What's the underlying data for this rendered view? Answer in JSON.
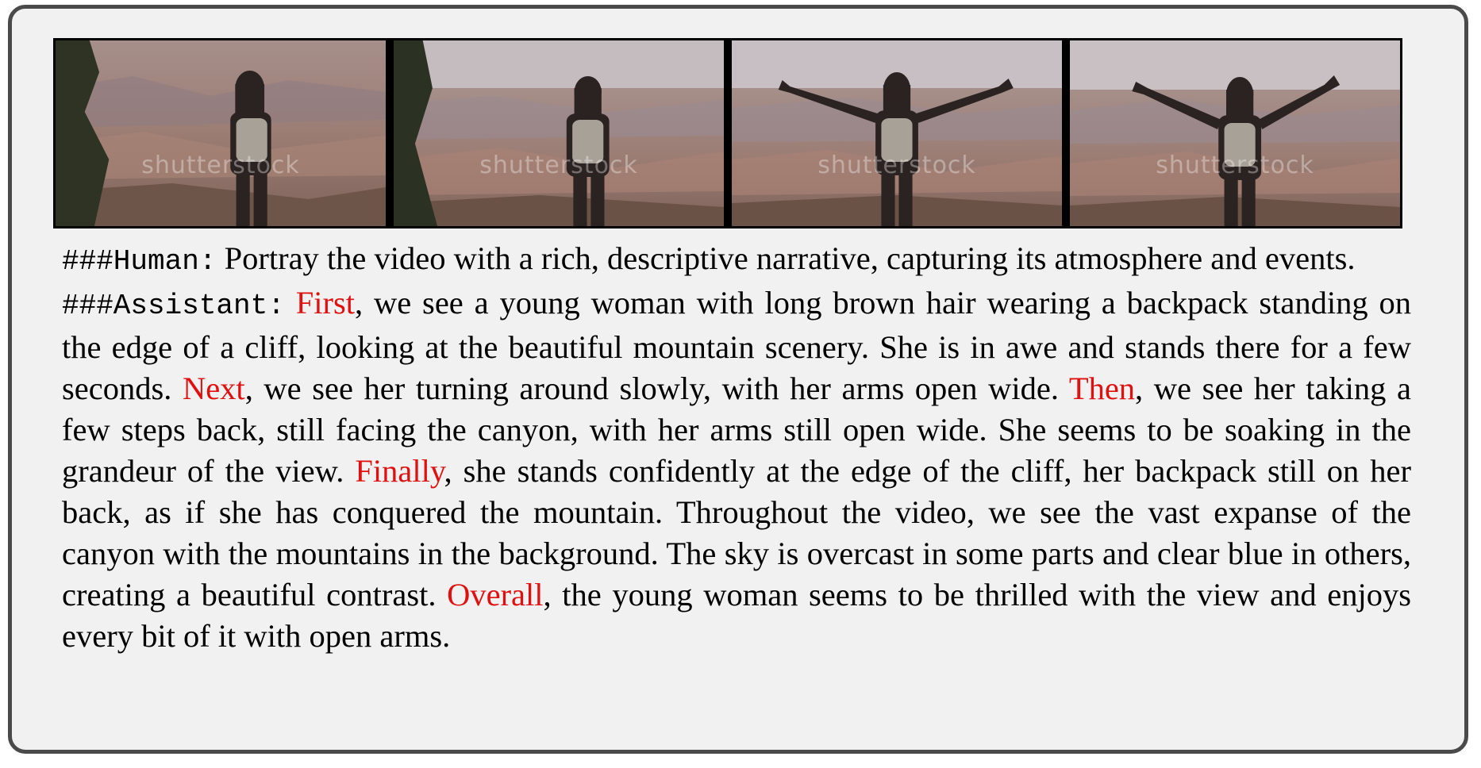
{
  "frames": [
    {
      "watermark": "shutterstock"
    },
    {
      "watermark": "shutterstock"
    },
    {
      "watermark": "shutterstock"
    },
    {
      "watermark": "shutterstock"
    }
  ],
  "human": {
    "label": "###Human:",
    "text": " Portray the video with a rich, descriptive narrative, capturing its atmosphere and events."
  },
  "assistant": {
    "label": "###Assistant:",
    "segments": [
      {
        "text": " ",
        "highlight": false
      },
      {
        "text": "First",
        "highlight": true
      },
      {
        "text": ", we see a young woman with long brown hair wearing a backpack standing on the edge of a cliff, looking at the beautiful mountain scenery. She is in awe and stands there for a few seconds. ",
        "highlight": false
      },
      {
        "text": "Next",
        "highlight": true
      },
      {
        "text": ", we see her turning around slowly, with her arms open wide. ",
        "highlight": false
      },
      {
        "text": "Then",
        "highlight": true
      },
      {
        "text": ", we see her taking a few steps back, still facing the canyon, with her arms still open wide. She seems to be soaking in the grandeur of the view. ",
        "highlight": false
      },
      {
        "text": "Finally",
        "highlight": true
      },
      {
        "text": ", she stands confidently at the edge of the cliff, her backpack still on her back, as if she has conquered the mountain. Throughout the video, we see the vast expanse of the canyon with the mountains in the background. The sky is overcast in some parts and clear blue in others, creating a beautiful contrast. ",
        "highlight": false
      },
      {
        "text": "Overall",
        "highlight": true
      },
      {
        "text": ", the young woman seems to be thrilled with the view and enjoys every bit of it with open arms.",
        "highlight": false
      }
    ]
  },
  "colors": {
    "highlight": "#e01010",
    "border": "#4a4a4a",
    "background": "#f1f1f1"
  }
}
